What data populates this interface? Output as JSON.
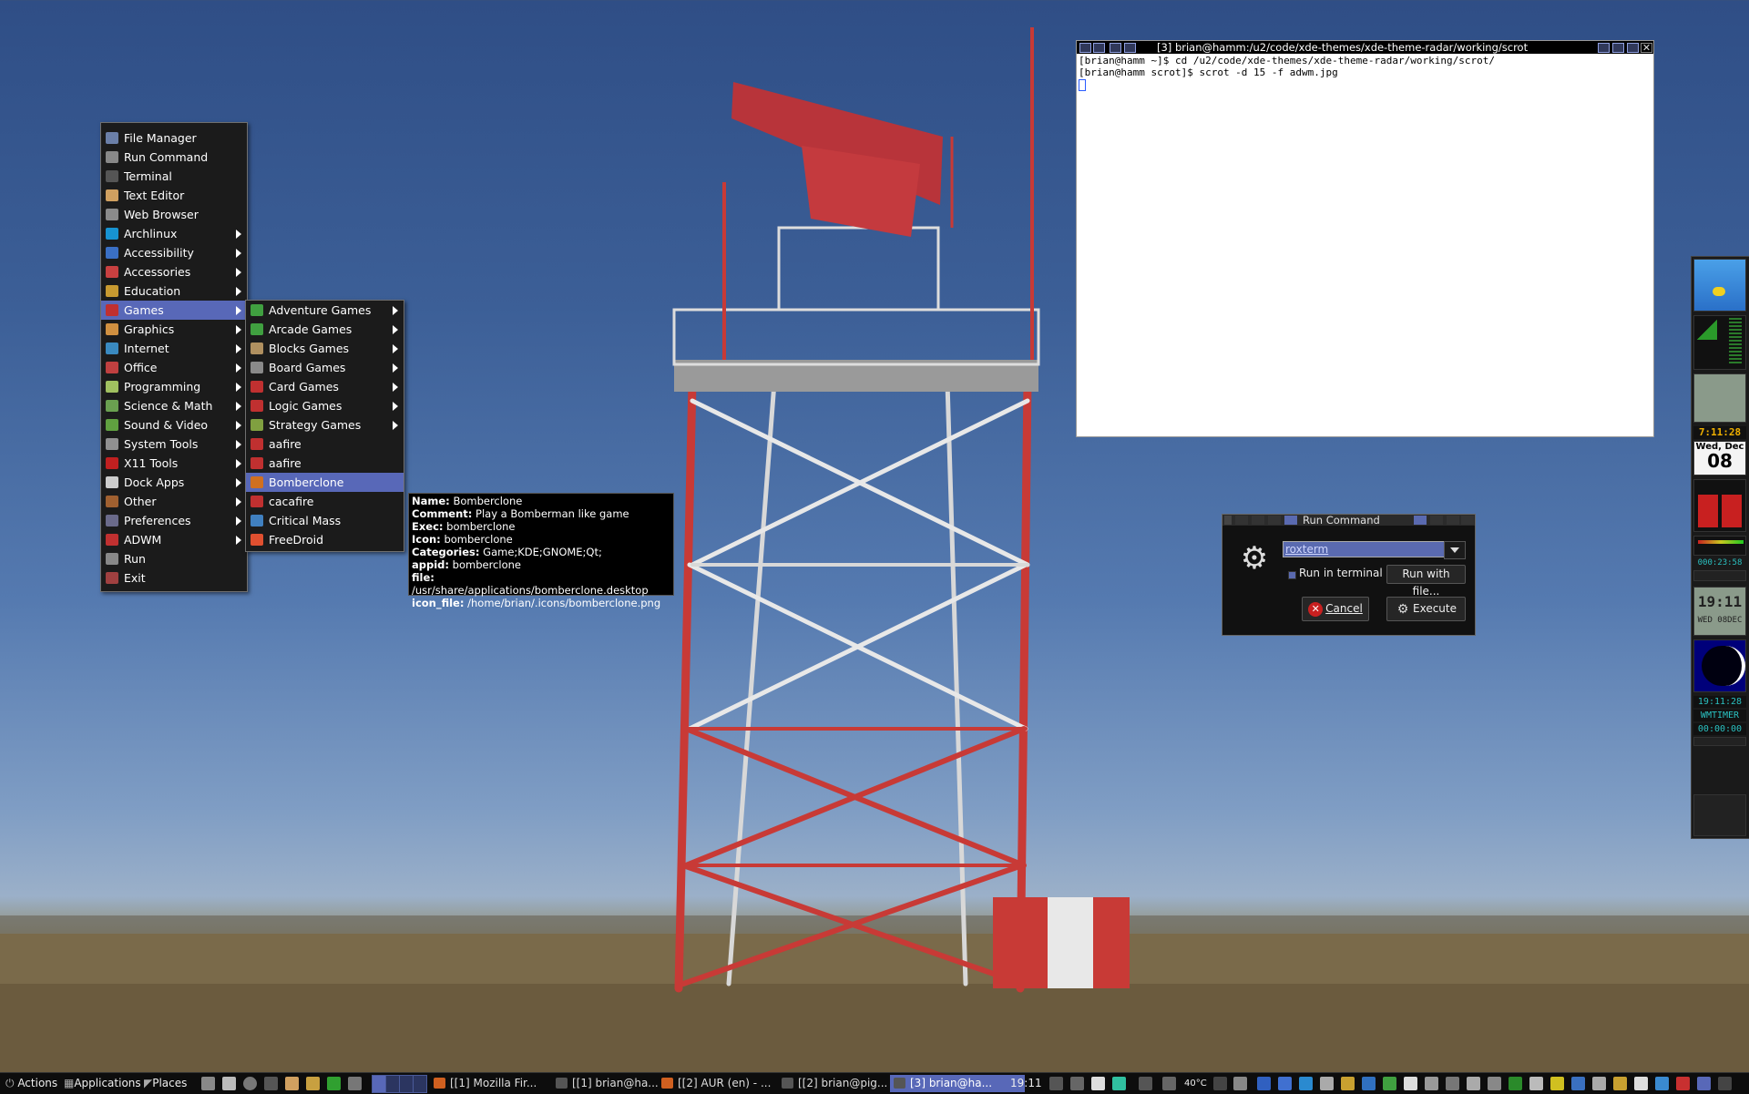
{
  "main_menu": {
    "items": [
      {
        "label": "File Manager",
        "icon": "file-manager-icon",
        "color": "#6b7fa8",
        "submenu": false
      },
      {
        "label": "Run Command",
        "icon": "run-command-icon",
        "color": "#888888",
        "submenu": false
      },
      {
        "label": "Terminal",
        "icon": "terminal-icon",
        "color": "#555555",
        "submenu": false
      },
      {
        "label": "Text Editor",
        "icon": "text-editor-icon",
        "color": "#d0a060",
        "submenu": false
      },
      {
        "label": "Web Browser",
        "icon": "web-browser-icon",
        "color": "#8a8a8a",
        "submenu": false
      },
      {
        "label": "Archlinux",
        "icon": "archlinux-icon",
        "color": "#1793d1",
        "submenu": true
      },
      {
        "label": "Accessibility",
        "icon": "accessibility-icon",
        "color": "#3a6fc4",
        "submenu": true
      },
      {
        "label": "Accessories",
        "icon": "accessories-icon",
        "color": "#c84040",
        "submenu": true
      },
      {
        "label": "Education",
        "icon": "education-icon",
        "color": "#c89a30",
        "submenu": true
      },
      {
        "label": "Games",
        "icon": "games-icon",
        "color": "#c03030",
        "submenu": true,
        "selected": true
      },
      {
        "label": "Graphics",
        "icon": "graphics-icon",
        "color": "#d09040",
        "submenu": true
      },
      {
        "label": "Internet",
        "icon": "internet-icon",
        "color": "#3a8ac0",
        "submenu": true
      },
      {
        "label": "Office",
        "icon": "office-icon",
        "color": "#c04040",
        "submenu": true
      },
      {
        "label": "Programming",
        "icon": "programming-icon",
        "color": "#a0c060",
        "submenu": true
      },
      {
        "label": "Science & Math",
        "icon": "science-math-icon",
        "color": "#6aa050",
        "submenu": true
      },
      {
        "label": "Sound & Video",
        "icon": "sound-video-icon",
        "color": "#60a040",
        "submenu": true
      },
      {
        "label": "System Tools",
        "icon": "system-tools-icon",
        "color": "#909090",
        "submenu": true
      },
      {
        "label": "X11 Tools",
        "icon": "x11-tools-icon",
        "color": "#c02020",
        "submenu": true
      },
      {
        "label": "Dock Apps",
        "icon": "dock-apps-icon",
        "color": "#cccccc",
        "submenu": true
      },
      {
        "label": "Other",
        "icon": "other-icon",
        "color": "#a06030",
        "submenu": true
      },
      {
        "label": "Preferences",
        "icon": "preferences-icon",
        "color": "#6a6a8a",
        "submenu": true
      },
      {
        "label": "ADWM",
        "icon": "adwm-icon",
        "color": "#c03030",
        "submenu": true
      },
      {
        "label": "Run",
        "icon": "run-icon",
        "color": "#888888",
        "submenu": false
      },
      {
        "label": "Exit",
        "icon": "exit-icon",
        "color": "#a04040",
        "submenu": false
      }
    ]
  },
  "games_menu": {
    "items": [
      {
        "label": "Adventure Games",
        "icon": "adventure-games-icon",
        "color": "#40a040",
        "submenu": true
      },
      {
        "label": "Arcade Games",
        "icon": "arcade-games-icon",
        "color": "#40a040",
        "submenu": true
      },
      {
        "label": "Blocks Games",
        "icon": "blocks-games-icon",
        "color": "#b09060",
        "submenu": true
      },
      {
        "label": "Board Games",
        "icon": "board-games-icon",
        "color": "#8a8a8a",
        "submenu": true
      },
      {
        "label": "Card Games",
        "icon": "card-games-icon",
        "color": "#c03030",
        "submenu": true
      },
      {
        "label": "Logic Games",
        "icon": "logic-games-icon",
        "color": "#c03030",
        "submenu": true
      },
      {
        "label": "Strategy Games",
        "icon": "strategy-games-icon",
        "color": "#80a040",
        "submenu": true
      },
      {
        "label": "aafire",
        "icon": "aafire-icon",
        "color": "#c03030",
        "submenu": false
      },
      {
        "label": "aafire",
        "icon": "aafire-icon",
        "color": "#c03030",
        "submenu": false
      },
      {
        "label": "Bomberclone",
        "icon": "bomberclone-icon",
        "color": "#d07020",
        "submenu": false,
        "selected": true
      },
      {
        "label": "cacafire",
        "icon": "cacafire-icon",
        "color": "#c03030",
        "submenu": false
      },
      {
        "label": "Critical Mass",
        "icon": "critical-mass-icon",
        "color": "#4080c0",
        "submenu": false
      },
      {
        "label": "FreeDroid",
        "icon": "freedroid-icon",
        "color": "#e05030",
        "submenu": false
      }
    ]
  },
  "tooltip": {
    "rows": [
      {
        "key": "Name:",
        "value": "Bomberclone"
      },
      {
        "key": "Comment:",
        "value": "Play a Bomberman like game"
      },
      {
        "key": "Exec:",
        "value": "bomberclone"
      },
      {
        "key": "Icon:",
        "value": "bomberclone"
      },
      {
        "key": "Categories:",
        "value": "Game;KDE;GNOME;Qt;"
      },
      {
        "key": "appid:",
        "value": "bomberclone"
      },
      {
        "key": "file:",
        "value": "/usr/share/applications/bomberclone.desktop"
      },
      {
        "key": "icon_file:",
        "value": "/home/brian/.icons/bomberclone.png"
      }
    ]
  },
  "terminal": {
    "title": "[3] brian@hamm:/u2/code/xde-themes/xde-theme-radar/working/scrot",
    "lines": [
      "[brian@hamm ~]$ cd /u2/code/xde-themes/xde-theme-radar/working/scrot/",
      "[brian@hamm scrot]$ scrot -d 15 -f adwm.jpg"
    ]
  },
  "run_command": {
    "title": "Run Command",
    "command_value": "roxterm",
    "run_in_terminal_label": "Run in terminal",
    "run_with_file_label": "Run with file...",
    "cancel_label": "Cancel",
    "execute_label": "Execute"
  },
  "dock": {
    "clock_time": "7:11:28",
    "date_day": "Wed, Dec",
    "date_num": "08",
    "lcd_time": "19:11",
    "lcd_date": "WED 08DEC",
    "digital_time": "19:11:28",
    "timer_label": "WMTIMER",
    "timer_value": "00:00:00",
    "net_counter": "000:23:58"
  },
  "taskbar": {
    "actions_label": "Actions",
    "applications_label": "Applications",
    "places_label": "Places",
    "tasks": [
      {
        "label": "[[1] Mozilla Fir...",
        "icon": "firefox-icon",
        "color": "#d06020",
        "active": false
      },
      {
        "label": "[[1] brian@ha...",
        "icon": "terminal-icon",
        "color": "#555555",
        "active": false
      },
      {
        "label": "[[2] AUR (en) - ...",
        "icon": "firefox-icon",
        "color": "#d06020",
        "active": false
      },
      {
        "label": "[[2] brian@pig...",
        "icon": "terminal-icon",
        "color": "#555555",
        "active": false
      },
      {
        "label": "[3] brian@ha...",
        "icon": "terminal-icon",
        "color": "#555555",
        "active": true
      }
    ],
    "clock": "19:11",
    "temperature": "40°C"
  }
}
